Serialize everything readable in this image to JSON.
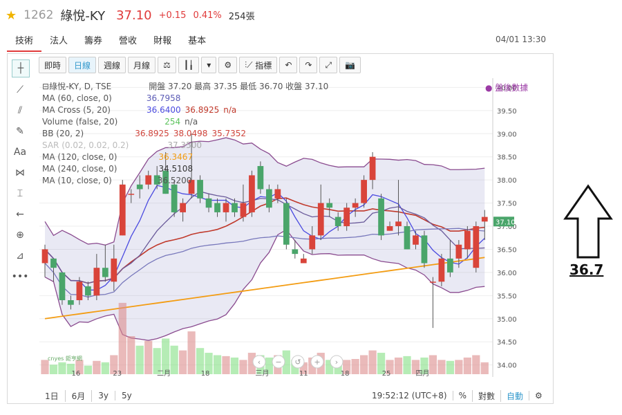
{
  "header": {
    "star_icon": "star-icon",
    "code": "1262",
    "name": "綠悅-KY",
    "price": "37.10",
    "change": "+0.15",
    "change_pct": "0.41%",
    "volume": "254張"
  },
  "tabs": [
    "技術",
    "法人",
    "籌券",
    "營收",
    "財報",
    "基本"
  ],
  "datetime": "04/01 13:30",
  "toolbar": {
    "buttons": [
      "即時",
      "日線",
      "週線",
      "月線"
    ],
    "indicator_label": "指標"
  },
  "left_tools": [
    "crosshair-icon",
    "trendline-icon",
    "fib-icon",
    "brush-icon",
    "text-icon",
    "pattern-icon",
    "measure-icon",
    "back-arrow-icon",
    "zoom-icon",
    "ruler-icon",
    "more-icon"
  ],
  "legend": {
    "main": {
      "label": "綠悅-KY, D, TSE",
      "ohlc": "開盤 37.20 最高 37.35 最低 36.70 收盤 37.10"
    },
    "rows": [
      {
        "label": "MA (60, close, 0)",
        "value": "36.7958",
        "color": "#5b5bb5"
      },
      {
        "label": "MA Cross (5, 20)",
        "value": "36.6400",
        "value2": "36.8925",
        "value3": "n/a",
        "color": "#4a4ae0",
        "color2": "#c0392b"
      },
      {
        "label": "Volume (false, 20)",
        "value": "254",
        "value2": "n/a",
        "color": "#5cc35c"
      },
      {
        "label": "BB (20, 2)",
        "value": "36.8925",
        "value2": "38.0498",
        "value3": "35.7352",
        "color": "#d0453c"
      },
      {
        "label": "SAR (0.02, 0.02, 0.2)",
        "value": "37.3500",
        "color": "#aaaaaa"
      },
      {
        "label": "MA (120, close, 0)",
        "value": "36.3467",
        "color": "#f39c12"
      },
      {
        "label": "MA (240, close, 0)",
        "value": "34.5108",
        "color": "#333333"
      },
      {
        "label": "MA (10, close, 0)",
        "value": "36.5200",
        "color": "#555555"
      }
    ],
    "after_hours": "● 盤後數據"
  },
  "price_axis": [
    "40.00",
    "39.50",
    "39.00",
    "38.50",
    "38.00",
    "37.50",
    "37.00",
    "36.50",
    "36.00",
    "35.50",
    "35.00",
    "34.50",
    "34.00"
  ],
  "last_price_tag": "37.10",
  "x_axis": [
    "16",
    "23",
    "二月",
    "18",
    "三月",
    "11",
    "18",
    "25",
    "四月"
  ],
  "bottom_ranges": [
    "1日",
    "6月",
    "3y",
    "5y"
  ],
  "bottom_right": {
    "time": "19:52:12 (UTC+8)",
    "pct": "%",
    "log": "對數",
    "auto": "自動"
  },
  "watermark": "cnyes 鉅亨網",
  "annotation": {
    "value": "36.7",
    "arrow": "up-arrow-icon"
  },
  "chart_data": {
    "type": "candlestick",
    "ylim": [
      33.8,
      40.2
    ],
    "candles": [
      {
        "o": 36.2,
        "c": 36.5,
        "h": 36.6,
        "l": 35.9
      },
      {
        "o": 36.3,
        "c": 36.1,
        "h": 36.3,
        "l": 35.8
      },
      {
        "o": 36.0,
        "c": 35.4,
        "h": 36.0,
        "l": 35.3
      },
      {
        "o": 35.4,
        "c": 35.3,
        "h": 35.5,
        "l": 35.2
      },
      {
        "o": 35.4,
        "c": 35.8,
        "h": 35.9,
        "l": 35.3
      },
      {
        "o": 35.7,
        "c": 35.5,
        "h": 35.8,
        "l": 35.4
      },
      {
        "o": 35.5,
        "c": 36.1,
        "h": 36.4,
        "l": 35.4
      },
      {
        "o": 36.1,
        "c": 35.9,
        "h": 36.6,
        "l": 35.8
      },
      {
        "o": 35.8,
        "c": 36.3,
        "h": 36.6,
        "l": 35.6
      },
      {
        "o": 36.8,
        "c": 37.9,
        "h": 38.0,
        "l": 36.8
      },
      {
        "o": 37.7,
        "c": 37.7,
        "h": 37.8,
        "l": 37.5
      },
      {
        "o": 37.9,
        "c": 37.8,
        "h": 38.1,
        "l": 37.6
      },
      {
        "o": 37.9,
        "c": 38.1,
        "h": 38.2,
        "l": 37.8
      },
      {
        "o": 38.1,
        "c": 37.9,
        "h": 38.3,
        "l": 37.8
      },
      {
        "o": 38.2,
        "c": 37.7,
        "h": 38.6,
        "l": 37.7
      },
      {
        "o": 37.9,
        "c": 37.3,
        "h": 38.0,
        "l": 37.2
      },
      {
        "o": 37.3,
        "c": 37.5,
        "h": 37.6,
        "l": 37.1
      },
      {
        "o": 37.7,
        "c": 38.0,
        "h": 39.0,
        "l": 37.6
      },
      {
        "o": 38.0,
        "c": 37.6,
        "h": 38.1,
        "l": 37.5
      },
      {
        "o": 37.6,
        "c": 37.4,
        "h": 37.7,
        "l": 37.3
      },
      {
        "o": 37.5,
        "c": 37.3,
        "h": 37.6,
        "l": 37.2
      },
      {
        "o": 37.3,
        "c": 37.5,
        "h": 37.6,
        "l": 37.1
      },
      {
        "o": 37.5,
        "c": 37.3,
        "h": 37.6,
        "l": 37.2
      },
      {
        "o": 37.2,
        "c": 37.5,
        "h": 37.9,
        "l": 37.1
      },
      {
        "o": 37.3,
        "c": 38.1,
        "h": 38.2,
        "l": 37.2
      },
      {
        "o": 38.3,
        "c": 37.8,
        "h": 38.4,
        "l": 37.7
      },
      {
        "o": 37.8,
        "c": 37.4,
        "h": 37.9,
        "l": 37.3
      },
      {
        "o": 37.6,
        "c": 37.8,
        "h": 37.9,
        "l": 37.5
      },
      {
        "o": 37.5,
        "c": 36.6,
        "h": 37.6,
        "l": 36.5
      },
      {
        "o": 36.5,
        "c": 36.4,
        "h": 36.7,
        "l": 36.3
      },
      {
        "o": 36.2,
        "c": 36.3,
        "h": 36.4,
        "l": 36.2
      },
      {
        "o": 36.5,
        "c": 36.8,
        "h": 37.0,
        "l": 36.4
      },
      {
        "o": 36.8,
        "c": 37.5,
        "h": 37.9,
        "l": 36.7
      },
      {
        "o": 37.5,
        "c": 37.4,
        "h": 37.6,
        "l": 37.2
      },
      {
        "o": 37.2,
        "c": 37.0,
        "h": 37.3,
        "l": 36.9
      },
      {
        "o": 37.0,
        "c": 37.4,
        "h": 37.5,
        "l": 36.9
      },
      {
        "o": 37.4,
        "c": 37.5,
        "h": 37.6,
        "l": 37.2
      },
      {
        "o": 37.5,
        "c": 38.0,
        "h": 38.1,
        "l": 37.4
      },
      {
        "o": 38.0,
        "c": 38.5,
        "h": 38.6,
        "l": 37.8
      },
      {
        "o": 37.6,
        "c": 36.8,
        "h": 37.7,
        "l": 36.7
      },
      {
        "o": 36.9,
        "c": 37.0,
        "h": 37.1,
        "l": 36.9
      },
      {
        "o": 37.0,
        "c": 37.1,
        "h": 38.0,
        "l": 36.8
      },
      {
        "o": 37.0,
        "c": 36.5,
        "h": 37.1,
        "l": 36.5
      },
      {
        "o": 36.6,
        "c": 36.8,
        "h": 36.9,
        "l": 36.5
      },
      {
        "o": 36.8,
        "c": 36.2,
        "h": 36.9,
        "l": 36.1
      },
      {
        "o": 35.8,
        "c": 35.8,
        "h": 35.9,
        "l": 34.8
      },
      {
        "o": 35.8,
        "c": 36.3,
        "h": 36.4,
        "l": 35.7
      },
      {
        "o": 36.3,
        "c": 36.0,
        "h": 36.7,
        "l": 35.9
      },
      {
        "o": 36.3,
        "c": 36.6,
        "h": 36.7,
        "l": 36.1
      },
      {
        "o": 36.5,
        "c": 36.9,
        "h": 37.0,
        "l": 36.3
      },
      {
        "o": 36.1,
        "c": 37.0,
        "h": 37.1,
        "l": 36.0
      },
      {
        "o": 37.1,
        "c": 37.2,
        "h": 37.35,
        "l": 36.7
      }
    ],
    "volumes": [
      30,
      20,
      25,
      22,
      30,
      18,
      28,
      25,
      40,
      150,
      80,
      60,
      70,
      55,
      75,
      60,
      50,
      90,
      55,
      45,
      40,
      38,
      35,
      30,
      45,
      40,
      35,
      40,
      50,
      30,
      25,
      35,
      45,
      30,
      28,
      30,
      32,
      40,
      50,
      45,
      30,
      35,
      38,
      30,
      35,
      40,
      30,
      28,
      30,
      35,
      40,
      25
    ]
  }
}
